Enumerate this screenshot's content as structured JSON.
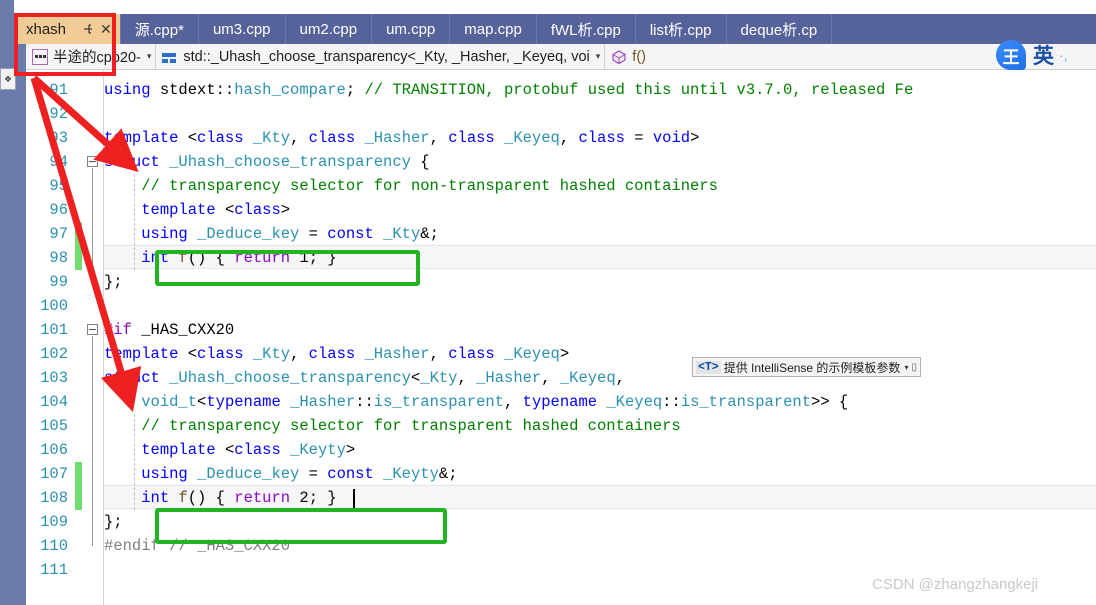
{
  "window": {
    "tabs": [
      {
        "label": "xhash",
        "active": true,
        "pin_icon": "pin-icon",
        "close_icon": "close-icon"
      },
      {
        "label": "源.cpp*",
        "active": false
      },
      {
        "label": "um3.cpp",
        "active": false
      },
      {
        "label": "um2.cpp",
        "active": false
      },
      {
        "label": "um.cpp",
        "active": false
      },
      {
        "label": "map.cpp",
        "active": false
      },
      {
        "label": "fWL析.cpp",
        "active": false
      },
      {
        "label": "list析.cpp",
        "active": false
      },
      {
        "label": "deque析.cp",
        "active": false
      }
    ]
  },
  "navbar": {
    "project": {
      "label": "半途的cpp20-",
      "icon": "project-icon",
      "caret": "▾"
    },
    "symbol": {
      "label": "std::_Uhash_choose_transparency<_Kty, _Hasher, _Keyeq, voi",
      "icon": "struct-icon",
      "caret": "▾"
    },
    "member": {
      "label": "f()",
      "icon": "method-icon"
    }
  },
  "editor": {
    "first_line": 91,
    "last_line": 111,
    "line_numbers": [
      91,
      92,
      93,
      94,
      95,
      96,
      97,
      98,
      99,
      100,
      101,
      102,
      103,
      104,
      105,
      106,
      107,
      108,
      109,
      110,
      111
    ],
    "changed_lines": [
      97,
      98,
      107,
      108
    ],
    "fold_lines": [
      94,
      101
    ],
    "lines": [
      {
        "n": 91,
        "tokens": [
          {
            "t": "using ",
            "c": "kw"
          },
          {
            "t": "stdext",
            "c": "op"
          },
          {
            "t": "::",
            "c": "op"
          },
          {
            "t": "hash_compare",
            "c": "type"
          },
          {
            "t": "; ",
            "c": "op"
          },
          {
            "t": "// TRANSITION, protobuf used this until v3.7.0, released Fe",
            "c": "cmt"
          }
        ]
      },
      {
        "n": 92,
        "tokens": []
      },
      {
        "n": 93,
        "tokens": [
          {
            "t": "template ",
            "c": "kw"
          },
          {
            "t": "<",
            "c": "op"
          },
          {
            "t": "class ",
            "c": "kw"
          },
          {
            "t": "_Kty",
            "c": "type"
          },
          {
            "t": ", ",
            "c": "op"
          },
          {
            "t": "class ",
            "c": "kw"
          },
          {
            "t": "_Hasher",
            "c": "type"
          },
          {
            "t": ", ",
            "c": "op"
          },
          {
            "t": "class ",
            "c": "kw"
          },
          {
            "t": "_Keyeq",
            "c": "type"
          },
          {
            "t": ", ",
            "c": "op"
          },
          {
            "t": "class ",
            "c": "kw"
          },
          {
            "t": "= ",
            "c": "op"
          },
          {
            "t": "void",
            "c": "kw"
          },
          {
            "t": ">",
            "c": "op"
          }
        ]
      },
      {
        "n": 94,
        "tokens": [
          {
            "t": "struct ",
            "c": "kw"
          },
          {
            "t": "_Uhash_choose_transparency",
            "c": "type"
          },
          {
            "t": " {",
            "c": "op"
          }
        ]
      },
      {
        "n": 95,
        "tokens": [
          {
            "t": "    // transparency selector for non-transparent hashed containers",
            "c": "cmt"
          }
        ]
      },
      {
        "n": 96,
        "tokens": [
          {
            "t": "    ",
            "c": "op"
          },
          {
            "t": "template ",
            "c": "kw"
          },
          {
            "t": "<",
            "c": "op"
          },
          {
            "t": "class",
            "c": "kw"
          },
          {
            "t": ">",
            "c": "op"
          }
        ]
      },
      {
        "n": 97,
        "tokens": [
          {
            "t": "    ",
            "c": "op"
          },
          {
            "t": "using ",
            "c": "kw"
          },
          {
            "t": "_Deduce_key",
            "c": "type"
          },
          {
            "t": " = ",
            "c": "op"
          },
          {
            "t": "const ",
            "c": "kw"
          },
          {
            "t": "_Kty",
            "c": "type"
          },
          {
            "t": "&;",
            "c": "op"
          }
        ]
      },
      {
        "n": 98,
        "tokens": [
          {
            "t": "    ",
            "c": "op"
          },
          {
            "t": "int ",
            "c": "kw"
          },
          {
            "t": "f",
            "c": "fn"
          },
          {
            "t": "() { ",
            "c": "op"
          },
          {
            "t": "return ",
            "c": "ctrl"
          },
          {
            "t": "1; }",
            "c": "op"
          }
        ]
      },
      {
        "n": 99,
        "tokens": [
          {
            "t": "};",
            "c": "op"
          }
        ]
      },
      {
        "n": 100,
        "tokens": []
      },
      {
        "n": 101,
        "tokens": [
          {
            "t": "#if ",
            "c": "pp"
          },
          {
            "t": "_HAS_CXX20",
            "c": "op"
          }
        ]
      },
      {
        "n": 102,
        "tokens": [
          {
            "t": "template ",
            "c": "kw"
          },
          {
            "t": "<",
            "c": "op"
          },
          {
            "t": "class ",
            "c": "kw"
          },
          {
            "t": "_Kty",
            "c": "type"
          },
          {
            "t": ", ",
            "c": "op"
          },
          {
            "t": "class ",
            "c": "kw"
          },
          {
            "t": "_Hasher",
            "c": "type"
          },
          {
            "t": ", ",
            "c": "op"
          },
          {
            "t": "class ",
            "c": "kw"
          },
          {
            "t": "_Keyeq",
            "c": "type"
          },
          {
            "t": ">",
            "c": "op"
          }
        ]
      },
      {
        "n": 103,
        "tokens": [
          {
            "t": "struct ",
            "c": "kw"
          },
          {
            "t": "_Uhash_choose_transparency",
            "c": "type"
          },
          {
            "t": "<",
            "c": "op"
          },
          {
            "t": "_Kty",
            "c": "type"
          },
          {
            "t": ", ",
            "c": "op"
          },
          {
            "t": "_Hasher",
            "c": "type"
          },
          {
            "t": ", ",
            "c": "op"
          },
          {
            "t": "_Keyeq",
            "c": "type"
          },
          {
            "t": ",",
            "c": "op"
          }
        ]
      },
      {
        "n": 104,
        "tokens": [
          {
            "t": "    ",
            "c": "op"
          },
          {
            "t": "void_t",
            "c": "type"
          },
          {
            "t": "<",
            "c": "op"
          },
          {
            "t": "typename ",
            "c": "kw"
          },
          {
            "t": "_Hasher",
            "c": "type"
          },
          {
            "t": "::",
            "c": "op"
          },
          {
            "t": "is_transparent",
            "c": "type"
          },
          {
            "t": ", ",
            "c": "op"
          },
          {
            "t": "typename ",
            "c": "kw"
          },
          {
            "t": "_Keyeq",
            "c": "type"
          },
          {
            "t": "::",
            "c": "op"
          },
          {
            "t": "is_transparent",
            "c": "type"
          },
          {
            "t": ">> {",
            "c": "op"
          }
        ]
      },
      {
        "n": 105,
        "tokens": [
          {
            "t": "    // transparency selector for transparent hashed containers",
            "c": "cmt"
          }
        ]
      },
      {
        "n": 106,
        "tokens": [
          {
            "t": "    ",
            "c": "op"
          },
          {
            "t": "template ",
            "c": "kw"
          },
          {
            "t": "<",
            "c": "op"
          },
          {
            "t": "class ",
            "c": "kw"
          },
          {
            "t": "_Keyty",
            "c": "type"
          },
          {
            "t": ">",
            "c": "op"
          }
        ]
      },
      {
        "n": 107,
        "tokens": [
          {
            "t": "    ",
            "c": "op"
          },
          {
            "t": "using ",
            "c": "kw"
          },
          {
            "t": "_Deduce_key",
            "c": "type"
          },
          {
            "t": " = ",
            "c": "op"
          },
          {
            "t": "const ",
            "c": "kw"
          },
          {
            "t": "_Keyty",
            "c": "type"
          },
          {
            "t": "&;",
            "c": "op"
          }
        ]
      },
      {
        "n": 108,
        "tokens": [
          {
            "t": "    ",
            "c": "op"
          },
          {
            "t": "int ",
            "c": "kw"
          },
          {
            "t": "f",
            "c": "fn"
          },
          {
            "t": "() { ",
            "c": "op"
          },
          {
            "t": "return ",
            "c": "ctrl"
          },
          {
            "t": "2; }",
            "c": "op"
          }
        ]
      },
      {
        "n": 109,
        "tokens": [
          {
            "t": "};",
            "c": "op"
          }
        ]
      },
      {
        "n": 110,
        "tokens": [
          {
            "t": "#endif // _HAS_CXX20",
            "c": "dim"
          }
        ]
      },
      {
        "n": 111,
        "tokens": []
      }
    ]
  },
  "tooltip": {
    "tag": "<T>",
    "text": "提供 IntelliSense 的示例模板参数",
    "caret": "▾",
    "end": "▯"
  },
  "ime": {
    "bubble_char": "王",
    "mode_char": "英",
    "dots": "·,"
  },
  "watermark": {
    "text": "CSDN @zhangzhangkeji"
  },
  "annotations": {
    "green_boxes": [
      "green-highlight-f1",
      "green-highlight-f2"
    ],
    "red_box": "red-highlight-tab",
    "arrows": [
      "red-arrow-to-struct-94",
      "red-arrow-to-struct-103"
    ]
  },
  "colors": {
    "tab_active_bg": "#f2cb95",
    "tabbar_bg": "#56629a",
    "keyword": "#0000ff",
    "type": "#2b91af",
    "comment": "#008000",
    "preprocessor": "#8f08c4",
    "function": "#74531f",
    "changebar": "#6fdd6f",
    "annotation_green": "#22b422",
    "annotation_red": "#ef2020"
  }
}
